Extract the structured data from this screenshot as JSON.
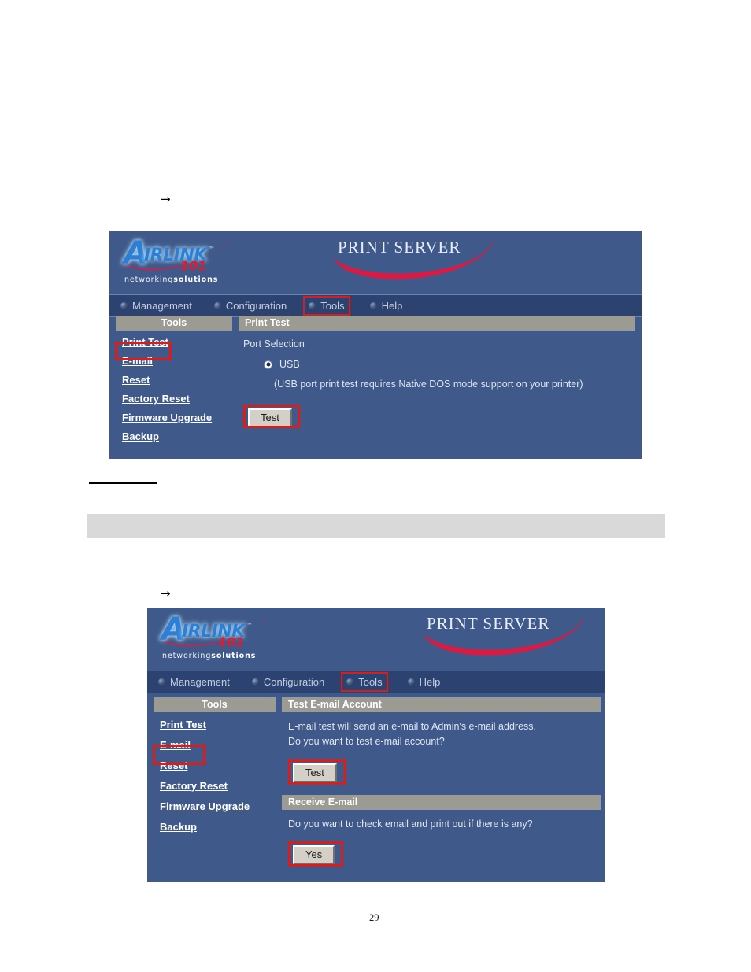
{
  "page": {
    "number": "29",
    "arrow_glyph": "→",
    "accent_red": "#e01b16",
    "panel_blue": "#3f5a8a",
    "nav_blue": "#2c4270",
    "header_gray": "#9b9b94",
    "band_gray": "#d9d9d9"
  },
  "markers": {
    "arrow_one": "→",
    "arrow_two": "→"
  },
  "screenshot_one": {
    "brand": {
      "logo_a": "A",
      "logo_rest": "IRLINK",
      "logo_tm": "™",
      "logo_101": "101",
      "tagline_light": "networking",
      "tagline_bold": "solutions"
    },
    "title": "PRINT SERVER",
    "nav": [
      {
        "label": "Management",
        "selected": false
      },
      {
        "label": "Configuration",
        "selected": false
      },
      {
        "label": "Tools",
        "selected": true
      },
      {
        "label": "Help",
        "selected": false
      }
    ],
    "sidebar": {
      "header": "Tools",
      "items": [
        {
          "label": "Print Test",
          "highlighted": true
        },
        {
          "label": "E-mail",
          "highlighted": false
        },
        {
          "label": "Reset",
          "highlighted": false
        },
        {
          "label": "Factory Reset",
          "highlighted": false
        },
        {
          "label": "Firmware Upgrade",
          "highlighted": false
        },
        {
          "label": "Backup",
          "highlighted": false
        }
      ]
    },
    "content": {
      "section_header": "Print Test",
      "port_selection_label": "Port Selection",
      "radio_label": "USB",
      "radio_selected": true,
      "note": "(USB port print test requires Native DOS mode support on your printer)",
      "button_label": "Test"
    }
  },
  "screenshot_two": {
    "brand": {
      "logo_a": "A",
      "logo_rest": "IRLINK",
      "logo_tm": "™",
      "logo_101": "101",
      "tagline_light": "networking",
      "tagline_bold": "solutions"
    },
    "title": "PRINT SERVER",
    "nav": [
      {
        "label": "Management",
        "selected": false
      },
      {
        "label": "Configuration",
        "selected": false
      },
      {
        "label": "Tools",
        "selected": true
      },
      {
        "label": "Help",
        "selected": false
      }
    ],
    "sidebar": {
      "header": "Tools",
      "items": [
        {
          "label": "Print Test",
          "highlighted": false
        },
        {
          "label": "E-mail",
          "highlighted": true
        },
        {
          "label": "Reset",
          "highlighted": false
        },
        {
          "label": "Factory Reset",
          "highlighted": false
        },
        {
          "label": "Firmware Upgrade",
          "highlighted": false
        },
        {
          "label": "Backup",
          "highlighted": false
        }
      ]
    },
    "content": {
      "test_section": {
        "header": "Test E-mail Account",
        "line1": "E-mail test will send an e-mail to Admin's e-mail address.",
        "line2": "Do you want to test e-mail account?",
        "button_label": "Test"
      },
      "receive_section": {
        "header": "Receive E-mail",
        "line1": "Do you want to check email and print out if there is any?",
        "button_label": "Yes"
      }
    }
  }
}
